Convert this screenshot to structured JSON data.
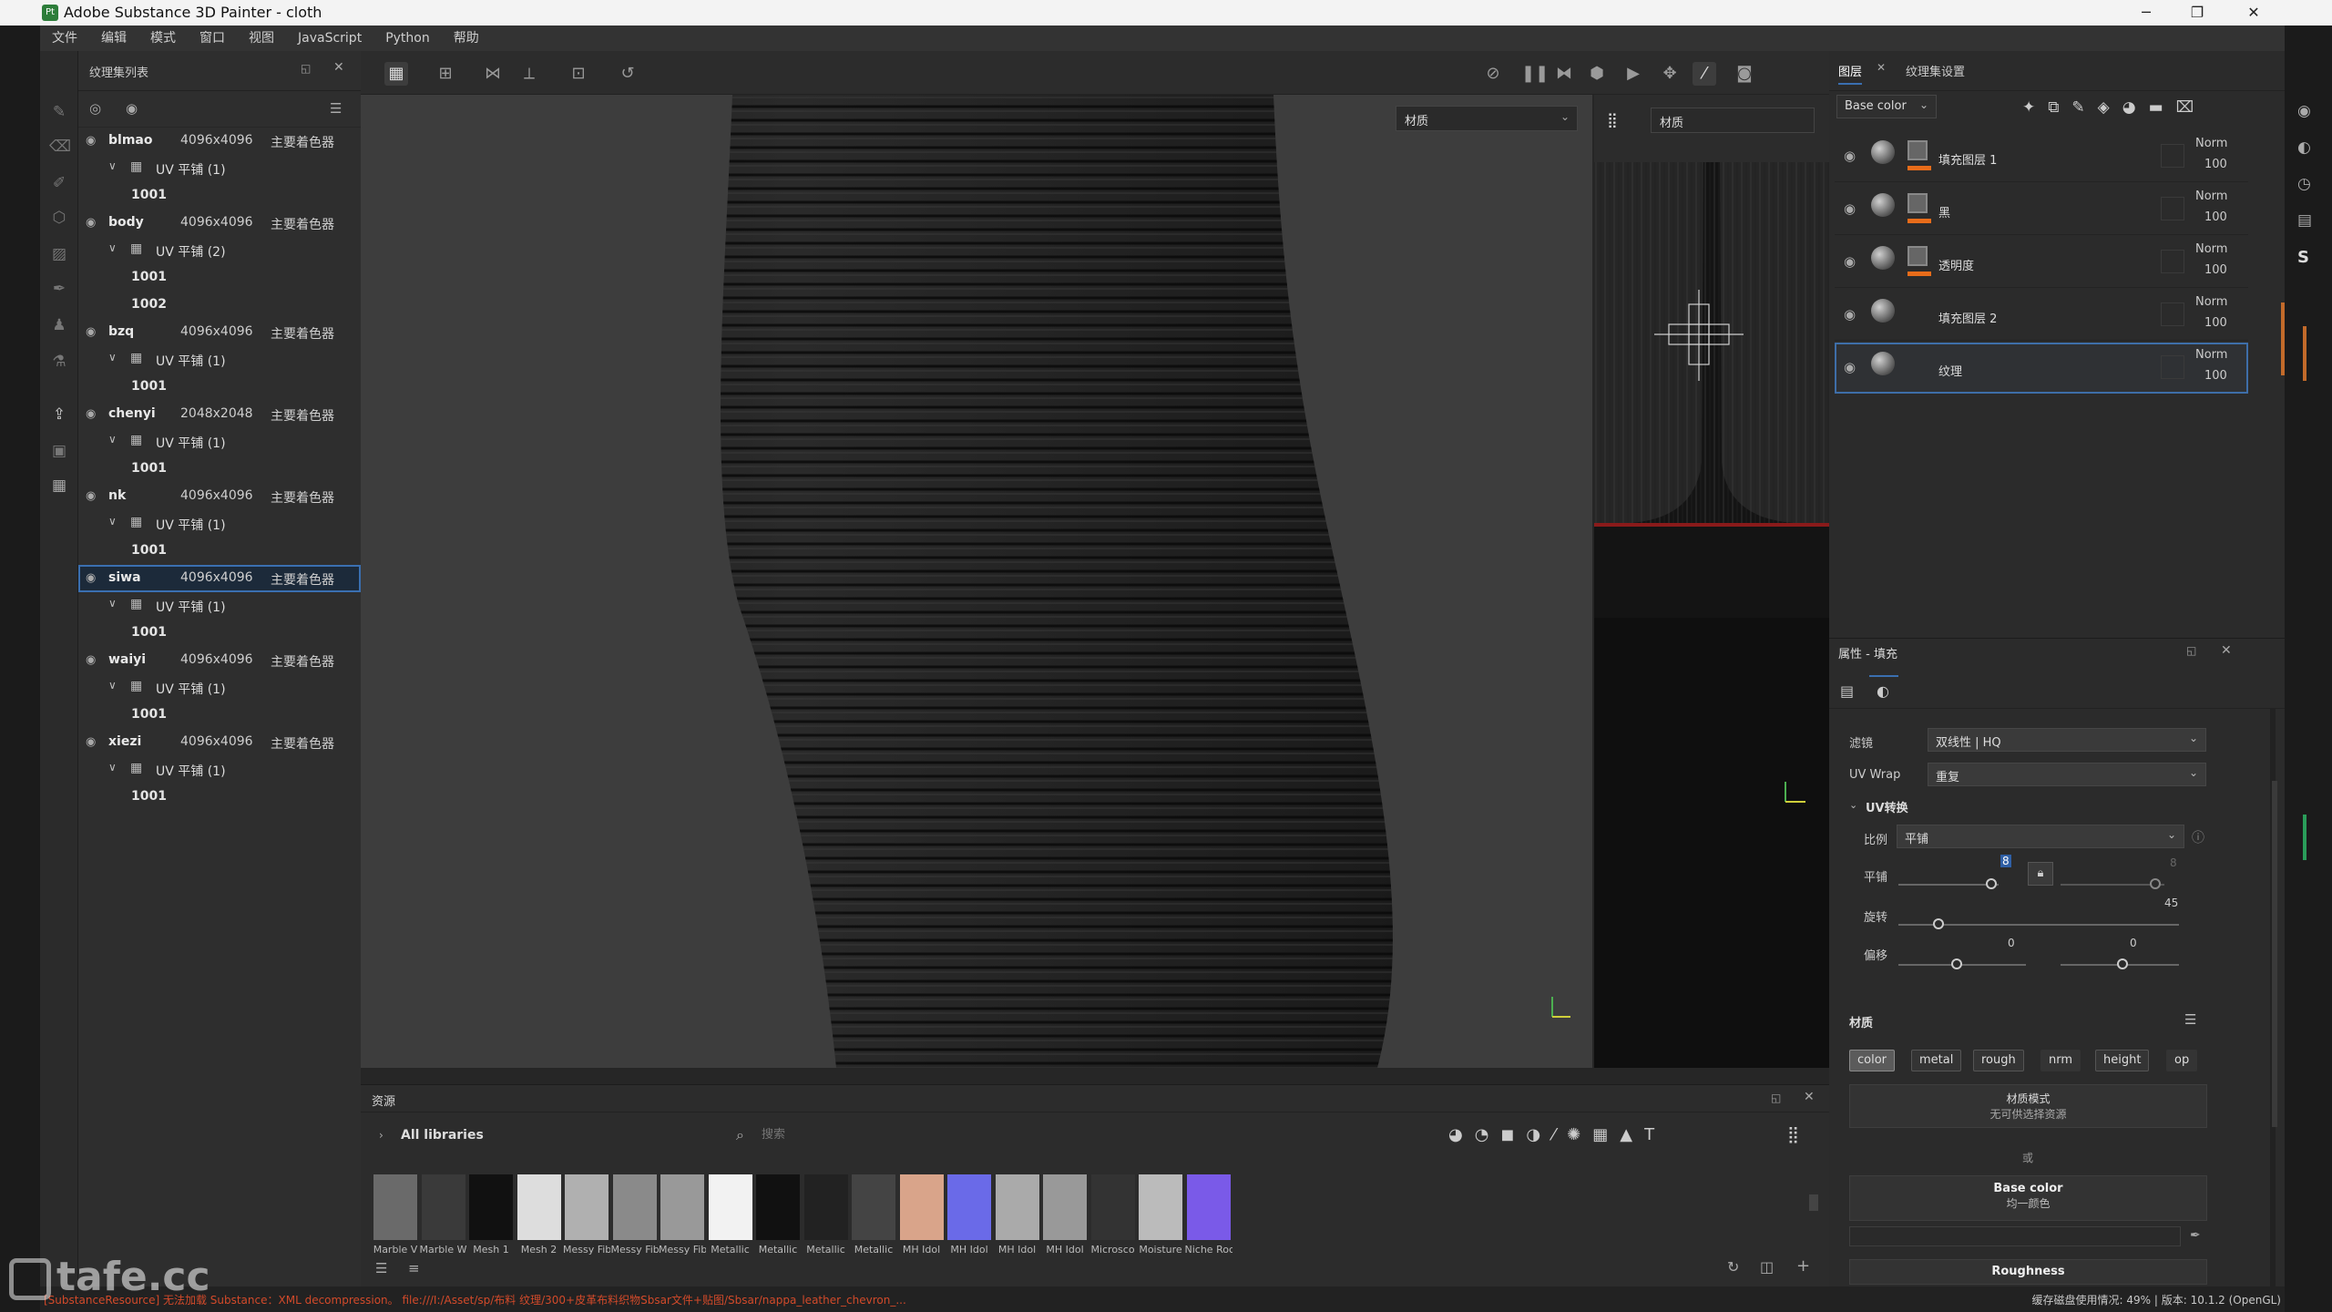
{
  "window": {
    "title": "Adobe Substance 3D Painter - cloth",
    "app_icon": "Pt"
  },
  "menu": [
    "文件",
    "编辑",
    "模式",
    "窗口",
    "视图",
    "JavaScript",
    "Python",
    "帮助"
  ],
  "texture_set_list": {
    "title": "纹理集列表",
    "sets": [
      {
        "name": "blmao",
        "size": "4096x4096",
        "shader": "主要着色器",
        "uv": "UV 平铺 (1)",
        "tiles": [
          "1001"
        ]
      },
      {
        "name": "body",
        "size": "4096x4096",
        "shader": "主要着色器",
        "uv": "UV 平铺 (2)",
        "tiles": [
          "1001",
          "1002"
        ]
      },
      {
        "name": "bzq",
        "size": "4096x4096",
        "shader": "主要着色器",
        "uv": "UV 平铺 (1)",
        "tiles": [
          "1001"
        ]
      },
      {
        "name": "chenyi",
        "size": "2048x2048",
        "shader": "主要着色器",
        "uv": "UV 平铺 (1)",
        "tiles": [
          "1001"
        ]
      },
      {
        "name": "nk",
        "size": "4096x4096",
        "shader": "主要着色器",
        "uv": "UV 平铺 (1)",
        "tiles": [
          "1001"
        ]
      },
      {
        "name": "siwa",
        "size": "4096x4096",
        "shader": "主要着色器",
        "uv": "UV 平铺 (1)",
        "tiles": [
          "1001"
        ],
        "selected": true
      },
      {
        "name": "waiyi",
        "size": "4096x4096",
        "shader": "主要着色器",
        "uv": "UV 平铺 (1)",
        "tiles": [
          "1001"
        ]
      },
      {
        "name": "xiezi",
        "size": "4096x4096",
        "shader": "主要着色器",
        "uv": "UV 平铺 (1)",
        "tiles": [
          "1001"
        ]
      }
    ]
  },
  "viewport": {
    "mode_3d": "材质",
    "mode_2d": "材质"
  },
  "assets": {
    "title": "资源",
    "library": "All libraries",
    "search_placeholder": "搜索",
    "items": [
      "Marble V",
      "Marble W",
      "Mesh 1",
      "Mesh 2",
      "Messy Fib",
      "Messy Fib",
      "Messy Fib",
      "Metallic",
      "Metallic",
      "Metallic",
      "Metallic",
      "MH Idol",
      "MH Idol",
      "MH Idol",
      "MH Idol",
      "Microsco",
      "Moisture",
      "Niche Roc"
    ]
  },
  "layers": {
    "tab_layers": "图层",
    "tab_texture_set": "纹理集设置",
    "channel": "Base color",
    "items": [
      {
        "name": "填充图层 1",
        "blend": "Norm",
        "opacity": "100",
        "has_mask": true
      },
      {
        "name": "黑",
        "blend": "Norm",
        "opacity": "100",
        "has_mask": true
      },
      {
        "name": "透明度",
        "blend": "Norm",
        "opacity": "100",
        "has_mask": true
      },
      {
        "name": "填充图层 2",
        "blend": "Norm",
        "opacity": "100",
        "has_mask": false
      },
      {
        "name": "纹理",
        "blend": "Norm",
        "opacity": "100",
        "has_mask": false,
        "selected": true
      }
    ]
  },
  "properties": {
    "title": "属性 - 填充",
    "filter_label": "滤镜",
    "filter_value": "双线性 | HQ",
    "uvwrap_label": "UV Wrap",
    "uvwrap_value": "重复",
    "uv_transform": "UV转换",
    "scale_label": "比例",
    "scale_value": "平铺",
    "tiling_label": "平铺",
    "tiling_value": "8",
    "tiling_value_faded": "8",
    "rotation_label": "旋转",
    "rotation_value": "45",
    "offset_label": "偏移",
    "offset_x": "0",
    "offset_y": "0",
    "material_label": "材质",
    "chips": [
      "color",
      "metal",
      "rough",
      "nrm",
      "height",
      "op"
    ],
    "material_mode_title": "材质模式",
    "material_mode_sub": "无可供选择资源",
    "or_text": "或",
    "base_color_title": "Base color",
    "base_color_sub": "均一颜色",
    "roughness_title": "Roughness"
  },
  "status": {
    "error": "[SubstanceResource] 无法加载 Substance：XML decompression。 file:///I:/Asset/sp/布料 纹理/300+皮革布料织物Sbsar文件+贴图/Sbsar/nappa_leather_chevron_...",
    "info": "缓存磁盘使用情况:  49% | 版本: 10.1.2 (OpenGL)"
  },
  "watermark": "tafe.cc",
  "colors": {
    "accent": "#3a6fb0",
    "mask_bar": "#e86c1a",
    "error": "#d24a2a",
    "chip_selected": "#5b5b5b"
  }
}
